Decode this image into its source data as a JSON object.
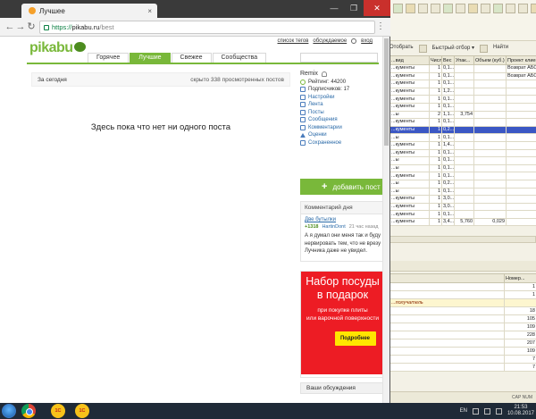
{
  "browser": {
    "tab_title": "Лучшее",
    "tab_close": "×",
    "url_secure": "https://",
    "url_host": "pikabu.ru",
    "url_path": "/best",
    "nav_back": "←",
    "nav_forward": "→",
    "nav_reload": "↻",
    "menu": "⋮",
    "win_min": "—",
    "win_max": "❐",
    "win_close": "✕"
  },
  "pikabu": {
    "logo": "pikabu",
    "top_links": [
      "список тегов",
      "обсуждаемое",
      "вход"
    ],
    "tabs": [
      "Горячее",
      "Лучшие",
      "Свежее",
      "Сообщества"
    ],
    "active_tab_index": 1,
    "feed": {
      "period": "За сегодня",
      "hidden_info": "скрыто 338 просмотренных постов",
      "empty_message": "Здесь пока что нет ни одного поста"
    },
    "profile": {
      "username": "Remix",
      "rating": "Рейтинг: 44200",
      "subscribers": "Подписчиков: 17",
      "menu": [
        "Настройки",
        "Лента",
        "Посты",
        "Сообщения",
        "Комментарии",
        "Оценки",
        "Сохраненное"
      ]
    },
    "add_post_label": "добавить пост",
    "comment_of_day": {
      "header": "Комментарий дня",
      "post_title": "Две бутылки",
      "rating": "+1318",
      "author": "HartinDont",
      "time": "21 час назад",
      "text_lines": [
        "А я думал они меня так и буду",
        "нервировать тем, что не врезу",
        "Лучника даже не увидел."
      ]
    },
    "banner": {
      "heading_lines": [
        "Набор посуды",
        "в подарок"
      ],
      "sub_lines": [
        "при покупке плиты",
        "или варочной поверхности"
      ],
      "button": "Подробнее"
    },
    "my_discussions": "Ваши обсуждения"
  },
  "app1c": {
    "toolbar": [
      "Отобрать",
      "Быстрый отбор ▾",
      "Найти"
    ],
    "grid1_columns": [
      "...вид",
      "Число",
      "Вес",
      "Упак...",
      "Объем (куб.)",
      "Проект клиента"
    ],
    "grid1_rows": [
      [
        "...кументы",
        "1",
        "0,1...",
        "",
        "",
        "Возврат АБС"
      ],
      [
        "...кументы",
        "1",
        "0,1...",
        "",
        "",
        "Возврат АБС"
      ],
      [
        "...кументы",
        "1",
        "0,1...",
        "",
        "",
        ""
      ],
      [
        "...кументы",
        "1",
        "1,2...",
        "",
        "",
        ""
      ],
      [
        "...кументы",
        "1",
        "0,1...",
        "",
        "",
        ""
      ],
      [
        "...кументы",
        "1",
        "0,1...",
        "",
        "",
        ""
      ],
      [
        "...ы",
        "2",
        "1,1...",
        "3,754",
        "",
        ""
      ],
      [
        "...кументы",
        "1",
        "0,1...",
        "",
        "",
        ""
      ],
      [
        "...кументы",
        "1",
        "0,2...",
        "",
        "",
        ""
      ],
      [
        "...ы",
        "1",
        "0,1...",
        "",
        "",
        ""
      ],
      [
        "...кументы",
        "1",
        "1,4...",
        "",
        "",
        ""
      ],
      [
        "...кументы",
        "1",
        "0,1...",
        "",
        "",
        ""
      ],
      [
        "...ы",
        "1",
        "0,1...",
        "",
        "",
        ""
      ],
      [
        "...ы",
        "1",
        "0,1...",
        "",
        "",
        ""
      ],
      [
        "...кументы",
        "1",
        "0,1...",
        "",
        "",
        ""
      ],
      [
        "...ы",
        "1",
        "0,2...",
        "",
        "",
        ""
      ],
      [
        "...ы",
        "1",
        "0,1...",
        "",
        "",
        ""
      ],
      [
        "...кументы",
        "1",
        "3,0...",
        "",
        "",
        ""
      ],
      [
        "...кументы",
        "1",
        "3,0...",
        "",
        "",
        ""
      ],
      [
        "...кументы",
        "1",
        "0,1...",
        "",
        "",
        ""
      ],
      [
        "...кументы",
        "1",
        "3,4...",
        "5,760",
        "0,029",
        ""
      ]
    ],
    "grid1_selected_index": 8,
    "grid2_columns": [
      "",
      "Номер..."
    ],
    "grid2_rows": [
      [
        "",
        "1"
      ],
      [
        "",
        "1"
      ],
      [
        "...получатель",
        ""
      ],
      [
        "",
        "18"
      ],
      [
        "",
        "105"
      ],
      [
        "",
        "109"
      ],
      [
        "",
        "228"
      ],
      [
        "",
        "207"
      ],
      [
        "",
        "109"
      ],
      [
        "",
        "7"
      ],
      [
        "",
        "7"
      ]
    ],
    "status": "CAP  NUM"
  },
  "taskbar": {
    "apps": [
      "1С",
      "1С"
    ],
    "lang": "EN",
    "time": "21:53",
    "date": "10.08.2017"
  }
}
